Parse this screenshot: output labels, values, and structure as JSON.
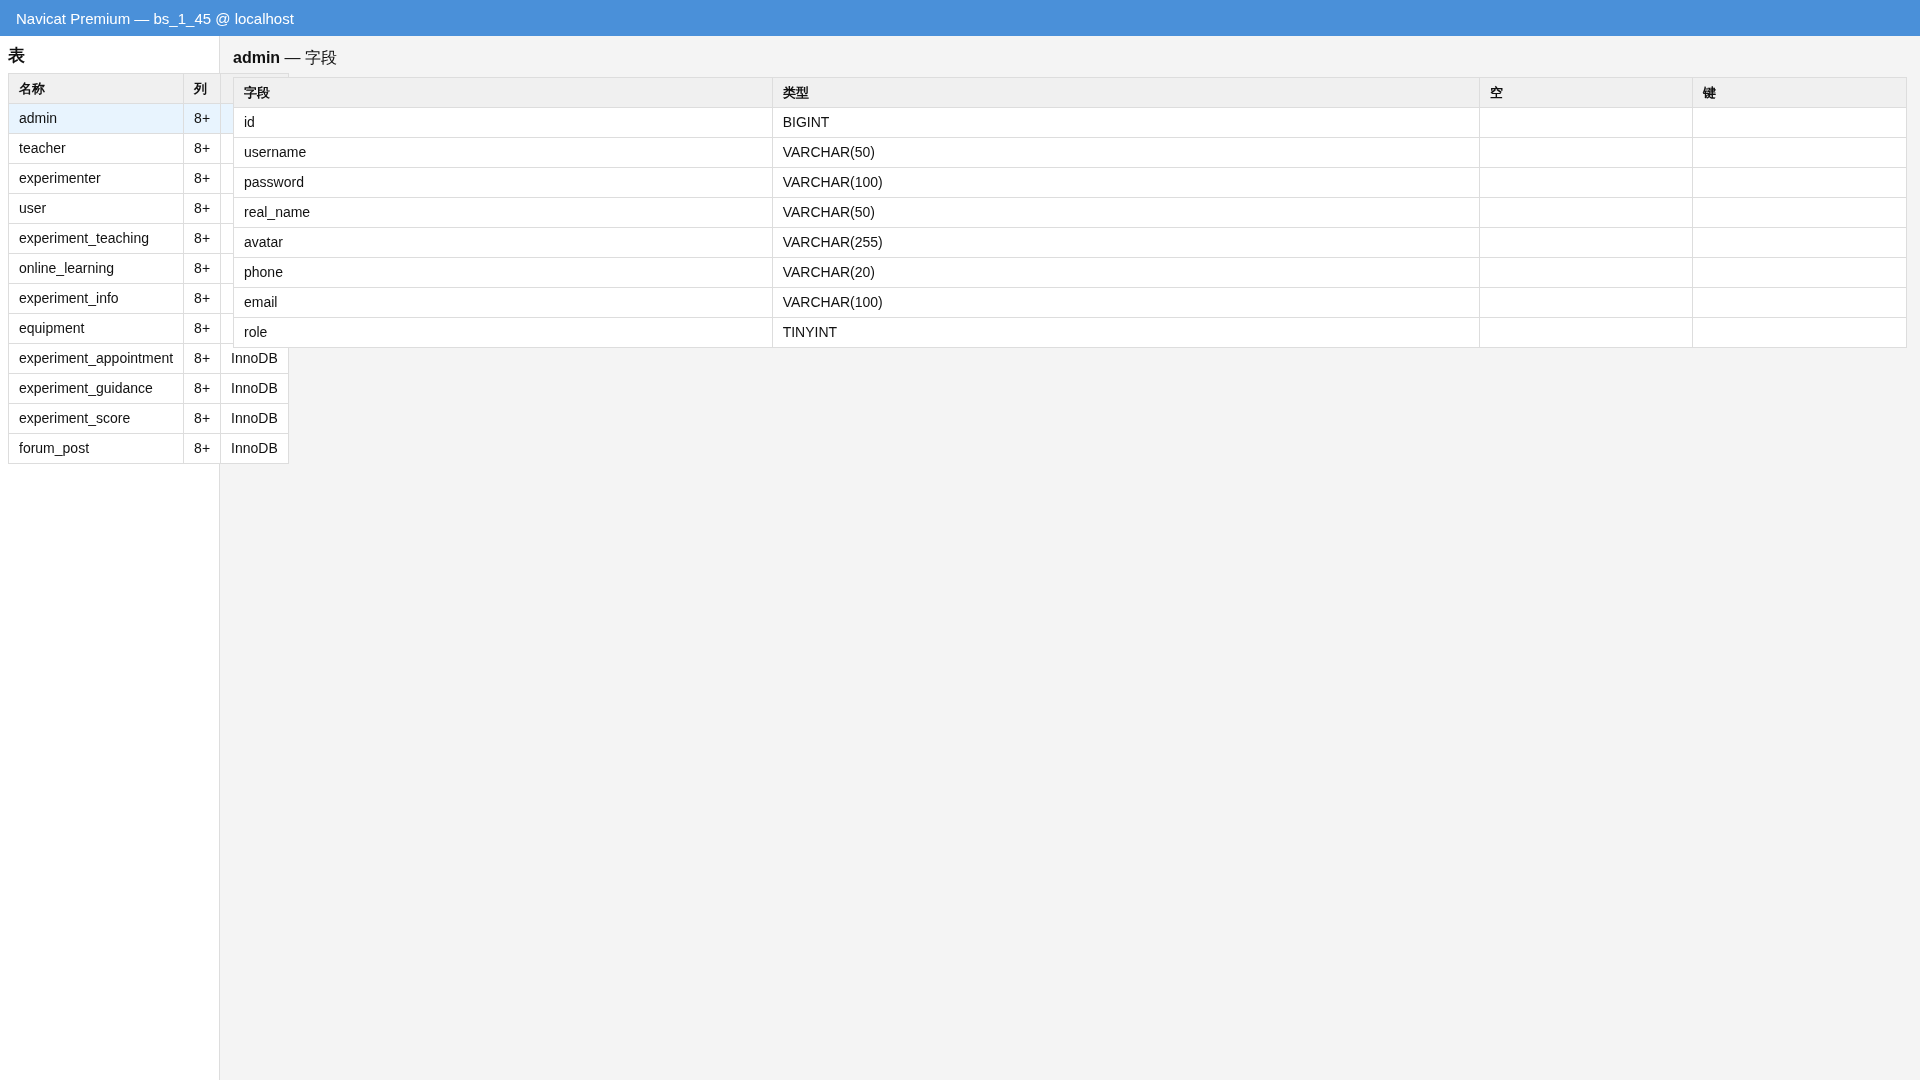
{
  "window": {
    "title": "Navicat Premium — bs_1_45 @ localhost"
  },
  "sidebar": {
    "title": "表",
    "table": {
      "columns": [
        "名称",
        "列"
      ],
      "rows": [
        {
          "name": "admin",
          "column_count": "8+",
          "selected": true
        },
        {
          "name": "teacher",
          "column_count": "8+",
          "selected": false
        },
        {
          "name": "experimenter",
          "column_count": "8+",
          "selected": false
        },
        {
          "name": "user",
          "column_count": "8+",
          "selected": false
        },
        {
          "name": "experiment_teaching",
          "column_count": "8+",
          "selected": false
        },
        {
          "name": "online_learning",
          "column_count": "8+",
          "selected": false
        },
        {
          "name": "experiment_info",
          "column_count": "8+",
          "selected": false
        },
        {
          "name": "equipment",
          "column_count": "8+",
          "selected": false
        },
        {
          "name": "experiment_appointment",
          "column_count": "8+",
          "column_3": "InnoDB",
          "selected": false
        },
        {
          "name": "experiment_guidance",
          "column_count": "8+",
          "column_3": "InnoDB",
          "selected": false
        },
        {
          "name": "experiment_score",
          "column_count": "8+",
          "column_3": "InnoDB",
          "selected": false
        },
        {
          "name": "forum_post",
          "column_count": "8+",
          "column_3": "InnoDB",
          "selected": false
        }
      ]
    }
  },
  "main": {
    "heading": "**admin** — 字段",
    "fields_table": {
      "columns": [
        "字段",
        "类型",
        "空",
        "键"
      ],
      "rows": [
        {
          "field": "id",
          "type": "BIGINT"
        },
        {
          "field": "username",
          "type": "VARCHAR(50)"
        },
        {
          "field": "password",
          "type": "VARCHAR(100)"
        },
        {
          "field": "real_name",
          "type": "VARCHAR(50)"
        },
        {
          "field": "avatar",
          "type": "VARCHAR(255)"
        },
        {
          "field": "phone",
          "type": "VARCHAR(20)"
        },
        {
          "field": "email",
          "type": "VARCHAR(100)"
        },
        {
          "field": "role",
          "type": "TINYINT"
        }
      ]
    }
  }
}
